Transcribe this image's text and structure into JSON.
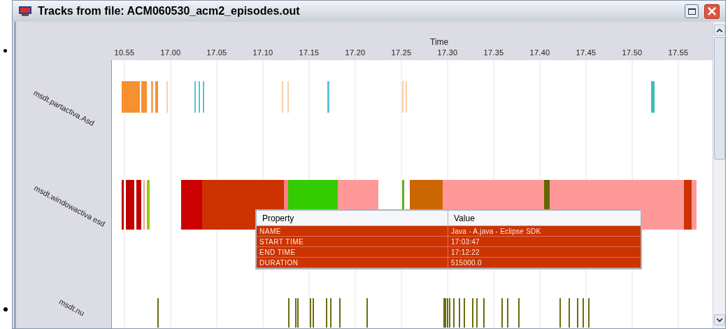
{
  "window": {
    "title": "Tracks from file:  ACM060530_acm2_episodes.out"
  },
  "axis": {
    "title": "Time",
    "ticks": [
      "10.55",
      "17.00",
      "17.05",
      "17.10",
      "17.15",
      "17.20",
      "17.25",
      "17.30",
      "17.35",
      "17.40",
      "17.45",
      "17.50",
      "17.55"
    ]
  },
  "tracks": [
    {
      "label": "msdt.partactiva.Asd"
    },
    {
      "label": "msdt.windowactiva esd"
    },
    {
      "label": "msdt.nu"
    }
  ],
  "tooltip": {
    "columns": [
      "Property",
      "Value"
    ],
    "rows": [
      {
        "property": "NAME",
        "value": "Java - A.java - Eclipse SDK"
      },
      {
        "property": "START TIME",
        "value": "17:03:47"
      },
      {
        "property": "END TIME",
        "value": "17:12:22"
      },
      {
        "property": "DURATION",
        "value": "515000.0"
      }
    ]
  }
}
